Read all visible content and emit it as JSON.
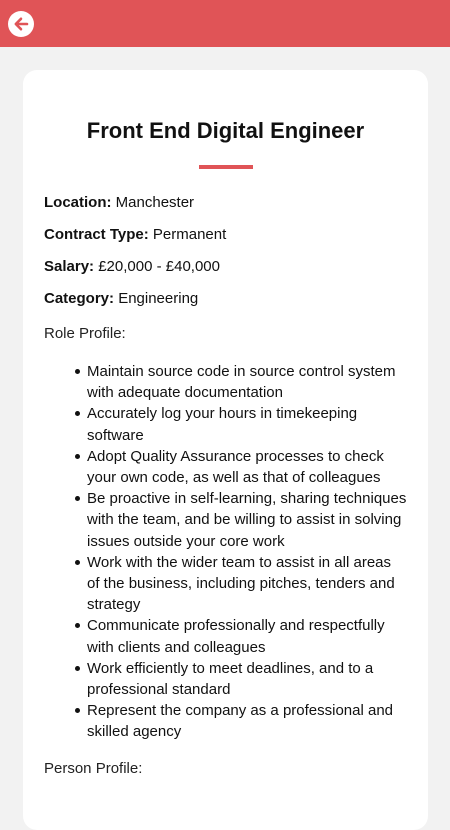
{
  "header": {
    "back_icon": "arrow-left-icon",
    "accent_color": "#e05457"
  },
  "job": {
    "title": "Front End Digital Engineer",
    "fields": [
      {
        "label": "Location:",
        "value": "Manchester"
      },
      {
        "label": "Contract Type:",
        "value": "Permanent"
      },
      {
        "label": "Salary:",
        "value": "£20,000 - £40,000"
      },
      {
        "label": "Category:",
        "value": "Engineering"
      }
    ],
    "role_profile_label": "Role Profile:",
    "role_profile_items": [
      "Maintain source code in source control system with adequate documentation",
      "Accurately log your hours in timekeeping software",
      "Adopt Quality Assurance processes to check your own code, as well as that of colleagues",
      "Be proactive in self-learning, sharing techniques with the team, and be willing to assist in solving issues outside your core work",
      "Work with the wider team to assist in all areas of the business, including pitches, tenders and strategy",
      "Communicate professionally and respectfully with clients and colleagues",
      "Work efficiently to meet deadlines, and to a professional standard",
      "Represent the company as a professional and skilled agency"
    ],
    "person_profile_label": "Person Profile:"
  }
}
